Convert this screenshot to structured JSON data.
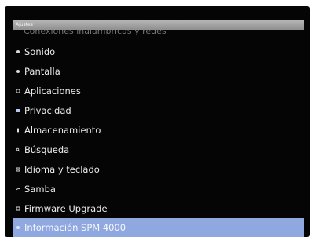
{
  "window": {
    "title": "Ajustes"
  },
  "menu": {
    "cut_item_label": "Conexiones inalámbricas y redes",
    "items": [
      {
        "label": "Sonido",
        "icon": "speaker-icon"
      },
      {
        "label": "Pantalla",
        "icon": "display-icon"
      },
      {
        "label": "Aplicaciones",
        "icon": "apps-icon"
      },
      {
        "label": "Privacidad",
        "icon": "privacy-icon"
      },
      {
        "label": "Almacenamiento",
        "icon": "storage-icon"
      },
      {
        "label": "Búsqueda",
        "icon": "search-icon"
      },
      {
        "label": "Idioma y teclado",
        "icon": "language-icon"
      },
      {
        "label": "Samba",
        "icon": "samba-icon"
      },
      {
        "label": "Firmware Upgrade",
        "icon": "firmware-icon"
      },
      {
        "label": "Información SPM 4000",
        "icon": "info-icon",
        "selected": true
      }
    ]
  },
  "colors": {
    "background": "#050505",
    "titlebar": "#a6a6a6",
    "selection": "#8fa8df",
    "text": "#ececec"
  }
}
